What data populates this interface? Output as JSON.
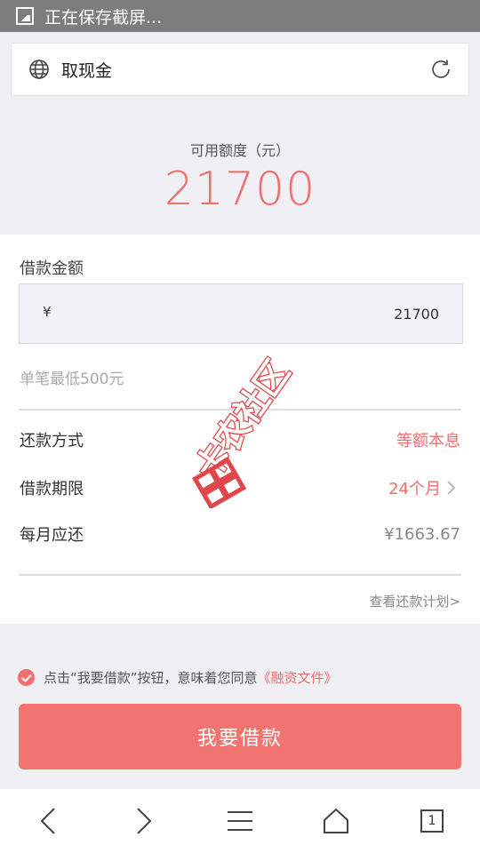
{
  "status_bar": {
    "notification": "正在保存截屏..."
  },
  "browser": {
    "page_title": "取现金"
  },
  "credit": {
    "label": "可用额度（元）",
    "amount": "21700"
  },
  "loan": {
    "amount_label": "借款金额",
    "currency_symbol": "¥",
    "amount_value": "21700",
    "min_note": "单笔最低500元",
    "repay_method_label": "还款方式",
    "repay_method_value": "等额本息",
    "term_label": "借款期限",
    "term_value": "24个月",
    "monthly_label": "每月应还",
    "monthly_value": "¥1663.67",
    "plan_link": "查看还款计划>"
  },
  "watermark": {
    "text": "卡农社区"
  },
  "agreement": {
    "text": "点击“我要借款”按钮，意味着您同意",
    "link": "《融资文件》"
  },
  "submit": {
    "label": "我要借款"
  },
  "nav": {
    "tab_count": "1"
  },
  "colors": {
    "accent": "#ef6f6d",
    "button": "#f17470",
    "status_bar": "#7d7d7d"
  }
}
